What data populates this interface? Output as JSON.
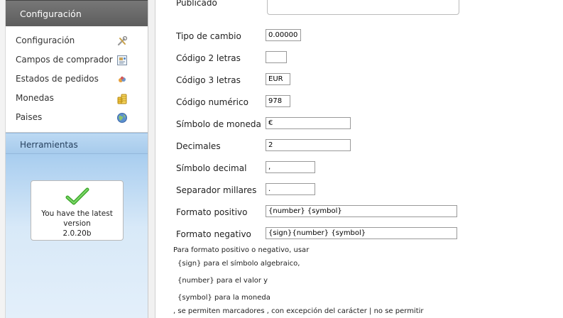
{
  "sidebar": {
    "header": "Configuración",
    "items": [
      {
        "label": "Configuración",
        "icon": "tools-icon"
      },
      {
        "label": "Campos de comprador",
        "icon": "fields-icon"
      },
      {
        "label": "Estados de pedidos",
        "icon": "order-status-icon"
      },
      {
        "label": "Monedas",
        "icon": "coins-icon"
      },
      {
        "label": "Paises",
        "icon": "globe-icon"
      }
    ],
    "tools_header": "Herramientas",
    "version": {
      "line1": "You have the latest",
      "line2": "version",
      "line3": "2.0.20b",
      "check_color": "#3fa82c"
    }
  },
  "form": {
    "published_label": "Publicado",
    "fields": [
      {
        "label": "Tipo de cambio",
        "value": "0.00000"
      },
      {
        "label": "Código 2 letras",
        "value": ""
      },
      {
        "label": "Código 3 letras",
        "value": "EUR"
      },
      {
        "label": "Código numérico",
        "value": "978"
      },
      {
        "label": "Símbolo de moneda",
        "value": "€"
      },
      {
        "label": "Decimales",
        "value": "2"
      },
      {
        "label": "Símbolo decimal",
        "value": ","
      },
      {
        "label": "Separador millares",
        "value": "."
      },
      {
        "label": "Formato positivo",
        "value": "{number} {symbol}"
      },
      {
        "label": "Formato negativo",
        "value": "{sign}{number} {symbol}"
      }
    ],
    "help": {
      "intro": "Para formato positivo o negativo, usar",
      "sign": "{sign} para el símbolo algebraico,",
      "number": "{number} para el valor y",
      "symbol": "{symbol} para la moneda",
      "note": ", se permiten marcadores , con excepción del carácter | no se permitir"
    }
  }
}
